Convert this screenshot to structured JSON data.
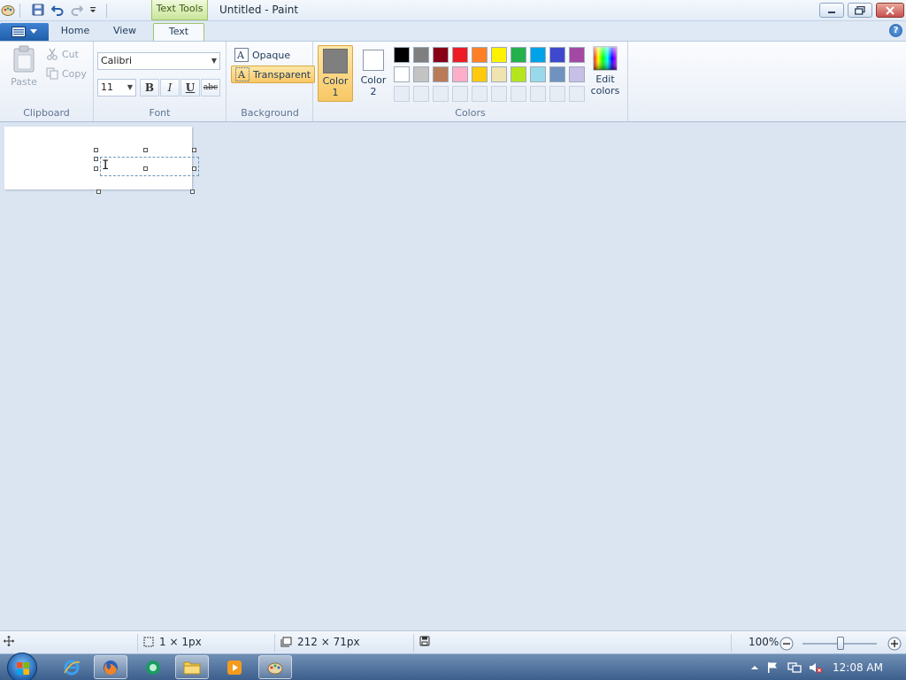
{
  "window": {
    "title": "Untitled - Paint",
    "context_tab": "Text Tools"
  },
  "tabs": [
    {
      "label": "Home"
    },
    {
      "label": "View"
    },
    {
      "label": "Text",
      "active": true
    }
  ],
  "ribbon": {
    "clipboard": {
      "paste": "Paste",
      "cut": "Cut",
      "copy": "Copy",
      "group_label": "Clipboard"
    },
    "font": {
      "family": "Calibri",
      "size": "11",
      "bold": "B",
      "italic": "I",
      "underline": "U",
      "strikethrough": "abc",
      "group_label": "Font"
    },
    "background": {
      "opaque": "Opaque",
      "transparent": "Transparent",
      "selected": "Transparent",
      "group_label": "Background"
    },
    "colors": {
      "color1_line1": "Color",
      "color1_line2": "1",
      "color2_line1": "Color",
      "color2_line2": "2",
      "edit_line1": "Edit",
      "edit_line2": "colors",
      "group_label": "Colors",
      "color1_value": "#7f7f7f",
      "color2_value": "#ffffff",
      "palette_row1": [
        "#000000",
        "#7f7f7f",
        "#880015",
        "#ed1c24",
        "#ff7f27",
        "#fff200",
        "#22b14c",
        "#00a2e8",
        "#3f48cc",
        "#a349a4"
      ],
      "palette_row2": [
        "#ffffff",
        "#c3c3c3",
        "#b97a57",
        "#ffaec9",
        "#ffc90e",
        "#efe4b0",
        "#b5e61d",
        "#99d9ea",
        "#7092be",
        "#c8bfe7"
      ],
      "palette_row3": [
        "",
        "",
        "",
        "",
        "",
        "",
        "",
        "",
        "",
        ""
      ]
    }
  },
  "status": {
    "cursor_pos": "1 × 1px",
    "canvas_size": "212 × 71px",
    "zoom": "100%"
  },
  "taskbar": {
    "clock": "12:08 AM"
  }
}
